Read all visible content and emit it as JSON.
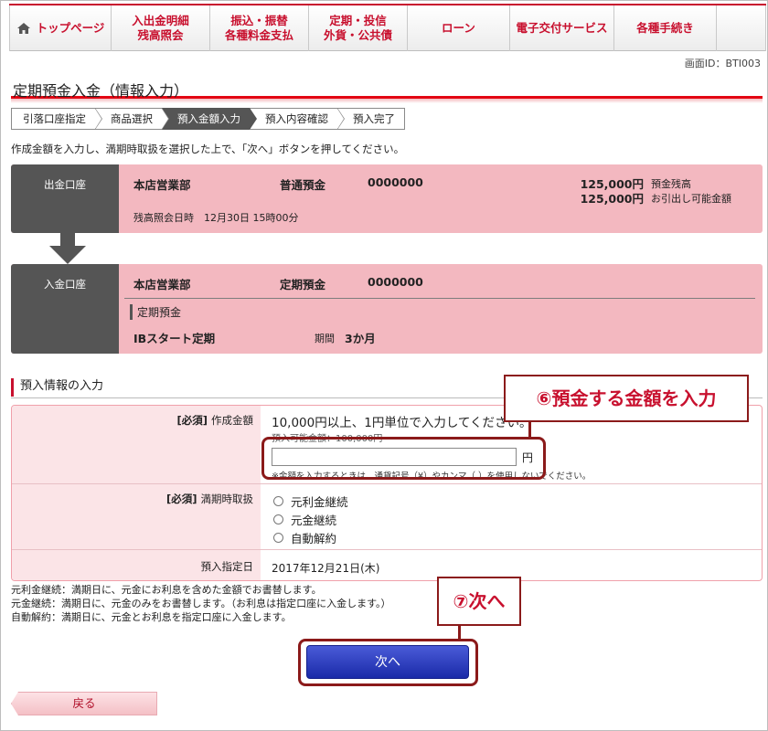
{
  "nav": {
    "items": [
      {
        "label": "トップページ",
        "icon": "home-icon"
      },
      {
        "label": "入出金明細\n残高照会"
      },
      {
        "label": "振込・振替\n各種料金支払"
      },
      {
        "label": "定期・投信\n外貨・公共債"
      },
      {
        "label": "ローン"
      },
      {
        "label": "電子交付サービス"
      },
      {
        "label": "各種手続き"
      }
    ]
  },
  "screen_id": "画面ID：BTI003",
  "page_title": "定期預金入金（情報入力）",
  "steps": [
    "引落口座指定",
    "商品選択",
    "預入金額入力",
    "預入内容確認",
    "預入完了"
  ],
  "active_step": "預入金額入力",
  "instruction": "作成金額を入力し、満期時取扱を選択した上で、「次へ」ボタンを押してください。",
  "withdraw_account": {
    "label": "出金口座",
    "branch": "本店営業部",
    "type": "普通預金",
    "number": "0000000",
    "balance": "125,000円",
    "balance_label": "預金残高",
    "available": "125,000円",
    "available_label": "お引出し可能金額",
    "balance_time": "残高照会日時　12月30日 15時00分"
  },
  "deposit_account": {
    "label": "入金口座",
    "branch": "本店営業部",
    "type": "定期預金",
    "number": "0000000",
    "plan_heading": "定期預金",
    "plan_name": "IBスタート定期",
    "term_label": "期間",
    "term": "3か月"
  },
  "section_title": "預入情報の入力",
  "form": {
    "required": "[必須]",
    "amount_label": "作成金額",
    "amount_hint": "10,000円以上、1円単位で入力してください。",
    "amount_available": "預入可能金額：100,000円",
    "amount_value": "",
    "amount_unit": "円",
    "amount_note": "※金額を入力するときは、通貨記号（¥）やカンマ（,）を使用しないでください。",
    "maturity_label": "満期時取扱",
    "maturity_options": [
      "元利金継続",
      "元金継続",
      "自動解約"
    ],
    "date_label": "預入指定日",
    "date_value": "2017年12月21日(木)"
  },
  "notes": [
    "元利金継続：満期日に、元金にお利息を含めた金額でお書替します。",
    "元金継続：満期日に、元金のみをお書替します。（お利息は指定口座に入金します。）",
    "自動解約：満期日に、元金とお利息を指定口座に入金します。"
  ],
  "callouts": {
    "step6": "⑥預金する金額を入力",
    "step7": "⑦次へ"
  },
  "buttons": {
    "next": "次へ",
    "back": "戻る"
  },
  "colors": {
    "brand": "#c8102e",
    "panel": "#f3b8c0",
    "label_bg": "#555555",
    "next_button": "#2233bb"
  }
}
